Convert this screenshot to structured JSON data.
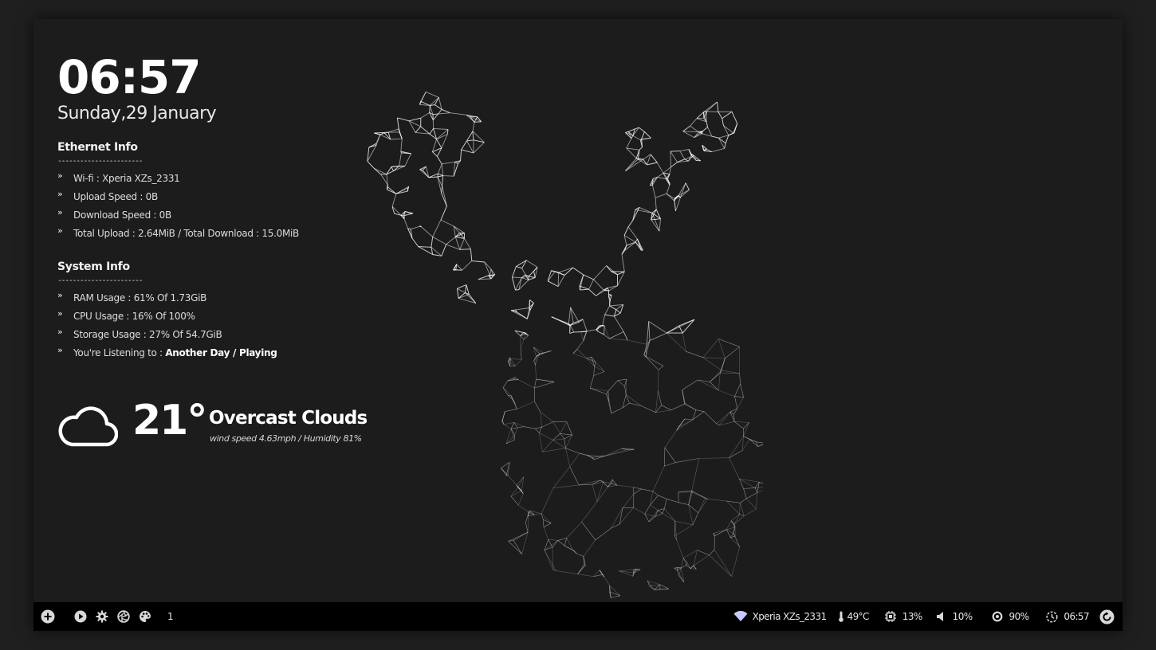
{
  "clock": {
    "time": "06:57",
    "date": "Sunday,29 January"
  },
  "ethernet": {
    "title": "Ethernet Info",
    "rule": "-----------------------",
    "items": [
      {
        "text": "Wi-fi : Xperia XZs_2331"
      },
      {
        "text": "Upload Speed : 0B"
      },
      {
        "text": "Download Speed : 0B"
      },
      {
        "text": "Total Upload : 2.64MiB / Total Download : 15.0MiB"
      }
    ]
  },
  "system": {
    "title": "System Info",
    "rule": "-----------------------",
    "items": [
      {
        "text": "RAM Usage : 61% Of 1.73GiB"
      },
      {
        "text": "CPU Usage : 16% Of 100%"
      },
      {
        "text": "Storage Usage : 27% Of 54.7GiB"
      }
    ],
    "music_label": "You're Listening to : ",
    "music_value": "Another Day / Playing"
  },
  "weather": {
    "icon": "cloud-icon",
    "temperature": "21°",
    "condition": "Overcast Clouds",
    "detail": "wind speed 4.63mph / Humidity 81%"
  },
  "bar": {
    "left_icons": [
      "add-icon",
      "play-icon",
      "settings-icon",
      "aperture-icon",
      "palette-icon"
    ],
    "workspace": "1",
    "wifi": "Xperia XZs_2331",
    "temperature": "49°C",
    "cpu": "13%",
    "volume": "10%",
    "brightness": "90%",
    "time": "06:57"
  }
}
